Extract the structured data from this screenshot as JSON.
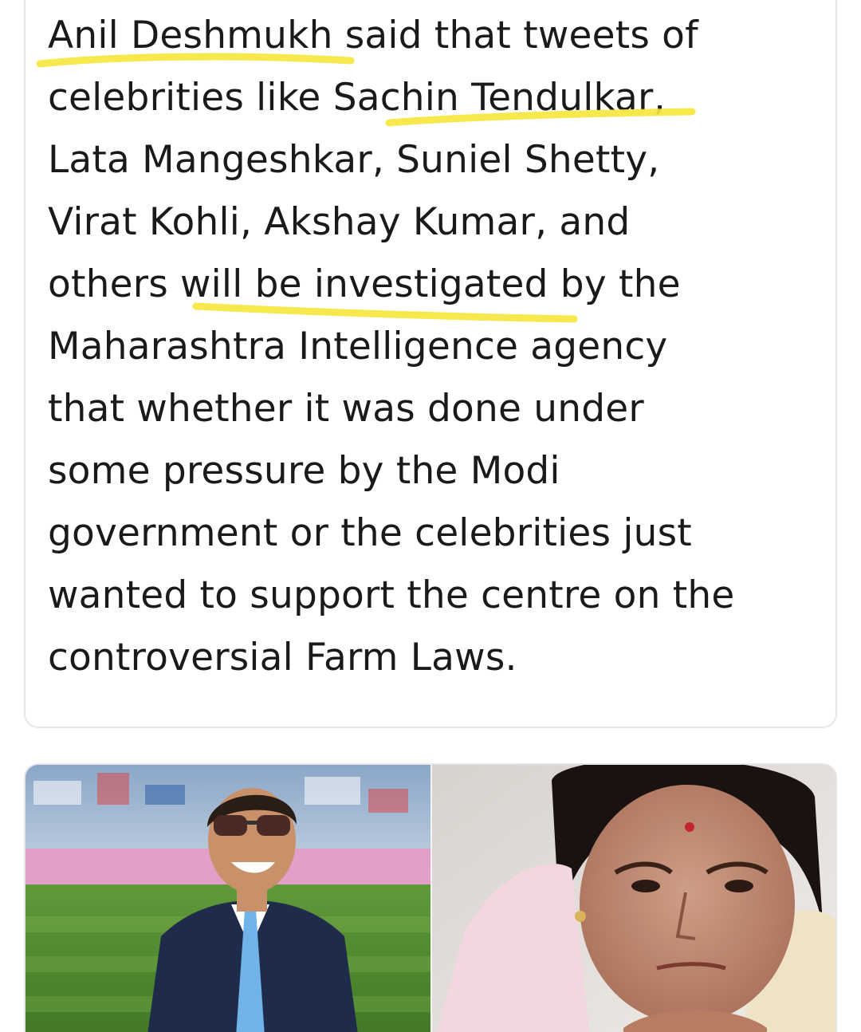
{
  "post": {
    "text_lines": [
      "Anil Deshmukh said that tweets of",
      "celebrities like Sachin Tendulkar,",
      "Lata Mangeshkar, Suniel Shetty,",
      "Virat Kohli, Akshay Kumar, and",
      "others will be investigated by the",
      "Maharashtra Intelligence agency",
      "that whether it was done under",
      "some pressure by the Modi",
      "government or the celebrities just",
      "wanted to support the centre on the",
      "controversial Farm Laws."
    ],
    "highlight_color": "#f5e63a"
  },
  "media": {
    "images": [
      {
        "subject": "man-in-suit-sunglasses-stadium"
      },
      {
        "subject": "elderly-woman-bindi-shawl"
      }
    ]
  }
}
